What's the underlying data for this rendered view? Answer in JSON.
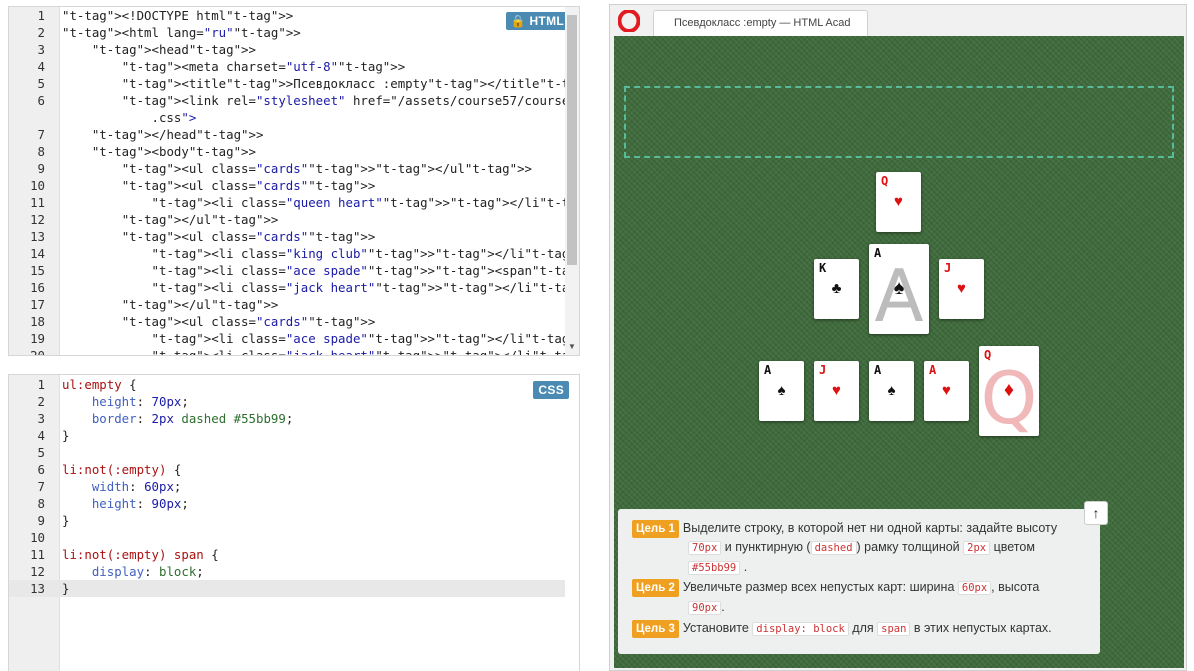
{
  "html_editor": {
    "badge": "HTML",
    "lines": [
      {
        "n": "1",
        "code": "<!DOCTYPE html>"
      },
      {
        "n": "2",
        "code": "<html lang=\"ru\">"
      },
      {
        "n": "3",
        "code": "    <head>"
      },
      {
        "n": "4",
        "code": "        <meta charset=\"utf-8\">"
      },
      {
        "n": "5",
        "code": "        <title>Псевдокласс :empty</title>"
      },
      {
        "n": "6",
        "code": "        <link rel=\"stylesheet\" href=\"/assets/course57/course"
      },
      {
        "n": "",
        "code": "            .css\">"
      },
      {
        "n": "7",
        "code": "    </head>"
      },
      {
        "n": "8",
        "code": "    <body>"
      },
      {
        "n": "9",
        "code": "        <ul class=\"cards\"></ul>"
      },
      {
        "n": "10",
        "code": "        <ul class=\"cards\">"
      },
      {
        "n": "11",
        "code": "            <li class=\"queen heart\"></li>"
      },
      {
        "n": "12",
        "code": "        </ul>"
      },
      {
        "n": "13",
        "code": "        <ul class=\"cards\">"
      },
      {
        "n": "14",
        "code": "            <li class=\"king club\"></li>"
      },
      {
        "n": "15",
        "code": "            <li class=\"ace spade\"><span>A</span></li>"
      },
      {
        "n": "16",
        "code": "            <li class=\"jack heart\"></li>"
      },
      {
        "n": "17",
        "code": "        </ul>"
      },
      {
        "n": "18",
        "code": "        <ul class=\"cards\">"
      },
      {
        "n": "19",
        "code": "            <li class=\"ace spade\"></li>"
      },
      {
        "n": "20",
        "code": "            <li class=\"jack heart\"></li>"
      }
    ]
  },
  "css_editor": {
    "badge": "CSS",
    "lines": [
      {
        "n": "1",
        "code": "ul:empty {"
      },
      {
        "n": "2",
        "code": "    height: 70px;"
      },
      {
        "n": "3",
        "code": "    border: 2px dashed #55bb99;"
      },
      {
        "n": "4",
        "code": "}"
      },
      {
        "n": "5",
        "code": ""
      },
      {
        "n": "6",
        "code": "li:not(:empty) {"
      },
      {
        "n": "7",
        "code": "    width: 60px;"
      },
      {
        "n": "8",
        "code": "    height: 90px;"
      },
      {
        "n": "9",
        "code": "}"
      },
      {
        "n": "10",
        "code": ""
      },
      {
        "n": "11",
        "code": "li:not(:empty) span {"
      },
      {
        "n": "12",
        "code": "    display: block;"
      },
      {
        "n": "13",
        "code": "}"
      }
    ]
  },
  "browser": {
    "tab_title": "Псевдокласс :empty — HTML Acad"
  },
  "cards": {
    "row1": [
      {
        "rank": "Q",
        "suit": "♥",
        "color": "red"
      }
    ],
    "row2": [
      {
        "rank": "K",
        "suit": "♣",
        "color": "black"
      },
      {
        "rank": "A",
        "suit": "♠",
        "color": "black",
        "big": "A"
      },
      {
        "rank": "J",
        "suit": "♥",
        "color": "red"
      }
    ],
    "row3": [
      {
        "rank": "A",
        "suit": "♠",
        "color": "black"
      },
      {
        "rank": "J",
        "suit": "♥",
        "color": "red"
      },
      {
        "rank": "A",
        "suit": "♠",
        "color": "black"
      },
      {
        "rank": "A",
        "suit": "♥",
        "color": "red"
      },
      {
        "rank": "Q",
        "suit": "♦",
        "color": "red",
        "big": "Q"
      }
    ]
  },
  "tasks": {
    "up_icon": "↑",
    "t1_goal": "Цель 1",
    "t1_text_a": "Выделите строку, в которой нет ни одной карты: задайте высоту",
    "t1_code1": "70px",
    "t1_text_b": "и пунктирную (",
    "t1_code2": "dashed",
    "t1_text_c": ") рамку толщиной",
    "t1_code3": "2px",
    "t1_text_d": "цветом",
    "t1_code4": "#55bb99",
    "t1_text_e": ".",
    "t2_goal": "Цель 2",
    "t2_text_a": "Увеличьте размер всех непустых карт: ширина",
    "t2_code1": "60px",
    "t2_text_b": ", высота",
    "t2_code2": "90px",
    "t2_text_c": ".",
    "t3_goal": "Цель 3",
    "t3_text_a": "Установите",
    "t3_code1": "display: block",
    "t3_text_b": "для",
    "t3_code2": "span",
    "t3_text_c": "в этих непустых картах."
  },
  "colors": {
    "accent": "#4a8ab3",
    "goal": "#f0a020",
    "table": "#3e6b3b",
    "dashed": "#55bb99"
  }
}
